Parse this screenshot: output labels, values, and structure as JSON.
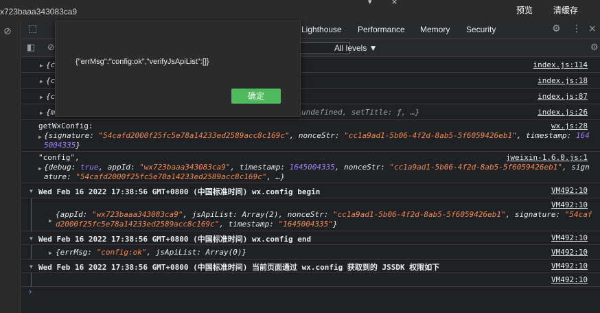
{
  "topbar": {
    "app_id": "x723baaa343083ca9",
    "preview_label": "预览",
    "clear_cache_label": "清缓存"
  },
  "tabs": [
    "Lighthouse",
    "Performance",
    "Memory",
    "Security"
  ],
  "console_toolbar": {
    "levels_label": "All levels ▼"
  },
  "dialog": {
    "message": "{\"errMsg\":\"config:ok\",\"verifyJsApiList\":[]}",
    "ok_label": "确定"
  },
  "console": {
    "row1": {
      "prefix": "{c",
      "source": "index.js:114"
    },
    "row2": {
      "prefix": "{c",
      "source": "index.js:18"
    },
    "row3": {
      "prefix": "{c",
      "source": "index.js:87"
    },
    "row4": {
      "prefix": "{m",
      "rest": "undefined, setTitle: ƒ, …}",
      "source": "index.js:26"
    },
    "row5": {
      "label": "getWxConfig:",
      "source": "wx.js:28",
      "l1_k1": "{signature: ",
      "l1_v1": "\"54cafd2000f25fc5e78a14233ed2589acc8c169c\"",
      "l1_k2": ", nonceStr: ",
      "l1_v2": "\"cc1a9ad1-5b06-4f2d-8ab5-5f6059426eb1\"",
      "l1_k3": ", timestamp: ",
      "l1_v3": "164",
      "l2_v3": "5004335",
      "l2_end": "}"
    },
    "row6": {
      "label": "\"config\",",
      "source": "jweixin-1.6.0.js:1",
      "l1_k1": "{debug: ",
      "l1_v1": "true",
      "l1_k2": ", appId: ",
      "l1_v2": "\"wx723baaa343083ca9\"",
      "l1_k3": ", timestamp: ",
      "l1_v3": "1645004335",
      "l1_k4": ", nonceStr: ",
      "l1_v4": "\"cc1a9ad1-5b06-4f2d-8ab5-5f6059426eb1\"",
      "l1_k5": ", sign",
      "l2_k5": "ature: ",
      "l2_v5": "\"54cafd2000f25fc5e78a14233ed2589acc8c169c\"",
      "l2_end": ", …}"
    },
    "group1": {
      "title": "Wed Feb 16 2022 17:38:56 GMT+0800 (中国标准时间) wx.config begin",
      "source": "VM492:10"
    },
    "group1_item": {
      "source": "VM492:10",
      "l1_k1": "{appId: ",
      "l1_v1": "\"wx723baaa343083ca9\"",
      "l1_k2": ", jsApiList: Array(2), nonceStr: ",
      "l1_v2": "\"cc1a9ad1-5b06-4f2d-8ab5-5f6059426eb1\"",
      "l1_k3": ", signature: ",
      "l1_v3": "\"54caf",
      "l2_v3": "d2000f25fc5e78a14233ed2589acc8c169c\"",
      "l2_k4": ", timestamp: ",
      "l2_v4": "\"1645004335\"",
      "l2_end": "}"
    },
    "group2": {
      "title": "Wed Feb 16 2022 17:38:56 GMT+0800 (中国标准时间) wx.config end",
      "source": "VM492:10"
    },
    "group2_item": {
      "k1": "{errMsg: ",
      "v1": "\"config:ok\"",
      "rest": ", jsApiList: Array(0)}",
      "source": "VM492:10"
    },
    "group3": {
      "title": "Wed Feb 16 2022 17:38:56 GMT+0800 (中国标准时间) 当前页面通过 wx.config 获取到的 JSSDK 权限如下",
      "source": "VM492:10"
    },
    "group3_item": {
      "source": "VM492:10"
    },
    "prompt": "›"
  }
}
